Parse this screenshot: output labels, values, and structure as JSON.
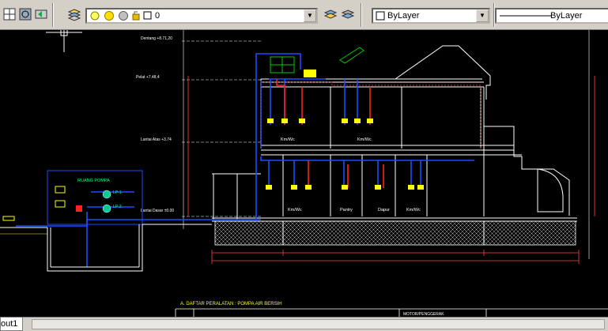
{
  "toolbar": {
    "layer_value": "0",
    "color_value": "ByLayer",
    "linetype_value": "ByLayer"
  },
  "drawing": {
    "level_labels": [
      "Dentang +8.71,20",
      "Pelat +7.48,4",
      "Lantai Atas +3.74",
      "Lantai Dasar ±0.00"
    ],
    "room_labels": [
      "Km/Wc",
      "Km/Wc",
      "Km/Wc",
      "Pantry",
      "Dapur",
      "Km/Wc"
    ],
    "pump_room_label": "RUANG POMPA",
    "pump_labels": [
      "LP-1",
      "LP-2"
    ],
    "schedule_title": "A. DAFTAR PERALATAN : POMPA AIR BERSIH",
    "schedule_header": "MOTOR/PENGGERAK"
  },
  "status": {
    "layout_tab": "out1"
  },
  "colors": {
    "background": "#000000",
    "wall": "#ffffff",
    "pipe_blue": "#1a4dff",
    "pipe_red": "#ff2020",
    "dimension": "#ff4040",
    "annotation": "#ffff00",
    "tank": "#00cc00"
  }
}
